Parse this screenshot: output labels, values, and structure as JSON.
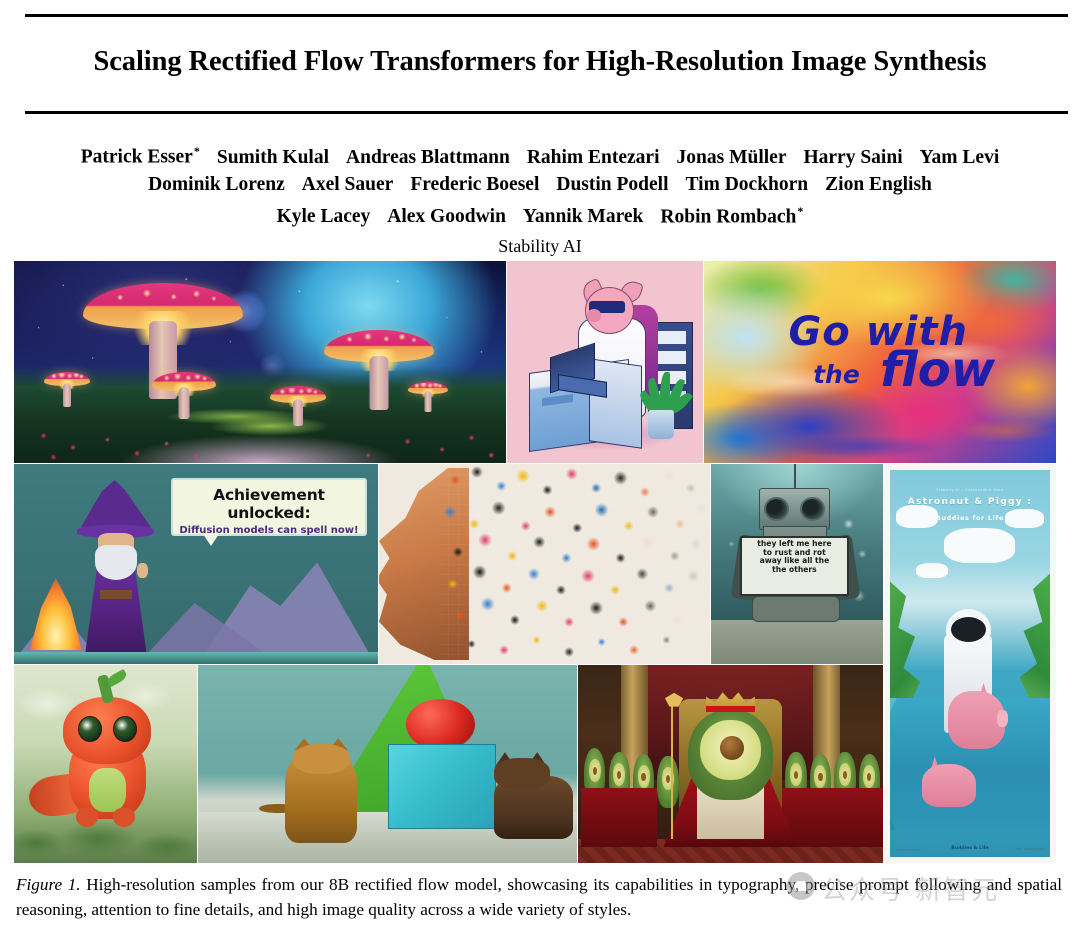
{
  "paper": {
    "title": "Scaling Rectified Flow Transformers for High-Resolution Image Synthesis",
    "authors_line1": [
      {
        "name": "Patrick Esser",
        "star": "*"
      },
      {
        "name": "Sumith Kulal",
        "star": ""
      },
      {
        "name": "Andreas Blattmann",
        "star": ""
      },
      {
        "name": "Rahim Entezari",
        "star": ""
      },
      {
        "name": "Jonas Müller",
        "star": ""
      },
      {
        "name": "Harry Saini",
        "star": ""
      },
      {
        "name": "Yam Levi",
        "star": ""
      }
    ],
    "authors_line2": [
      {
        "name": "Dominik Lorenz",
        "star": ""
      },
      {
        "name": "Axel Sauer",
        "star": ""
      },
      {
        "name": "Frederic Boesel",
        "star": ""
      },
      {
        "name": "Dustin Podell",
        "star": ""
      },
      {
        "name": "Tim Dockhorn",
        "star": ""
      },
      {
        "name": "Zion English",
        "star": ""
      }
    ],
    "authors_line3": [
      {
        "name": "Kyle Lacey",
        "star": ""
      },
      {
        "name": "Alex Goodwin",
        "star": ""
      },
      {
        "name": "Yannik Marek",
        "star": ""
      },
      {
        "name": "Robin Rombach",
        "star": "*"
      }
    ],
    "affiliation": "Stability AI"
  },
  "figure": {
    "caption_label": "Figure 1.",
    "caption_text": " High-resolution samples from our 8B rectified flow model, showcasing its capabilities in typography, precise prompt following and spatial reasoning, attention to fine details, and high image quality across a wide variety of styles.",
    "panels": {
      "mushrooms": {
        "alt": "glowing pink mushrooms under a blue planet in a cosmic night sky"
      },
      "pig_desk": {
        "alt": "isometric illustration of a pig in a lab coat with sunglasses typing on a laptop at a desk, pink background"
      },
      "go_with_the_flow": {
        "alt": "colorful abstract paint swirls with hand-lettered text",
        "text_line1": "Go with",
        "text_line2": "the",
        "text_line3": "flow",
        "text_color": "#1f1ea8"
      },
      "wizard": {
        "alt": "pixel-art wizard with a campfire and a speech bubble",
        "bubble_line1": "Achievement unlocked:",
        "bubble_line2": "Diffusion models can spell now!"
      },
      "pixel_face": {
        "alt": "profile of a face dissolving into colorful digital pixel squares"
      },
      "robot_sign": {
        "alt": "rusted robot sitting underwater holding a handwritten sign",
        "sign_line1": "they left me here",
        "sign_line2": "to rust and  rot",
        "sign_line3": "away like all the",
        "sign_line4": "the others"
      },
      "poster": {
        "alt": "low-poly poster of an astronaut riding a pig through a jungle river",
        "top_micro": "Stability AI — Independent Work",
        "title": "Astronaut & Piggy :",
        "subtitle": "Buddies for Life",
        "footer_center": "Buddies & Life",
        "footer_left": "Stability AI Studios",
        "footer_right": "2024 · Limited Edition"
      },
      "dino": {
        "alt": "cute orange dragon-pepper figurine with big green eyes on mossy ground"
      },
      "cat_cube_dog": {
        "alt": "a cat to the left of a cyan cube with a red sphere on top and a dog to the right"
      },
      "avocado_king": {
        "alt": "an avocado king wearing a crown seated on a throne with an avocado court"
      }
    }
  },
  "watermark": {
    "text": "公众号  新智元"
  }
}
